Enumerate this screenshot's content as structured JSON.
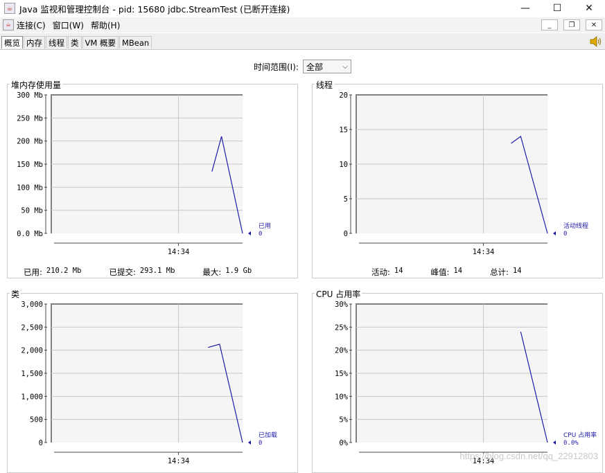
{
  "window": {
    "title": "Java 监视和管理控制台 - pid: 15680 jdbc.StreamTest (已断开连接)",
    "minimize_glyph": "—",
    "maximize_glyph": "☐",
    "close_glyph": "✕"
  },
  "menu": {
    "items": [
      {
        "label": "连接(C)"
      },
      {
        "label": "窗口(W)"
      },
      {
        "label": "帮助(H)"
      }
    ],
    "mdi_minimize": "_",
    "mdi_restore": "❐",
    "mdi_close": "✕"
  },
  "tabs": [
    {
      "label": "概览",
      "active": true
    },
    {
      "label": "内存"
    },
    {
      "label": "线程"
    },
    {
      "label": "类"
    },
    {
      "label": "VM 概要"
    },
    {
      "label": "MBean"
    }
  ],
  "time_range": {
    "label": "时间范围(I):",
    "selected": "全部"
  },
  "panels": {
    "heap": {
      "title": "堆内存使用量",
      "stats": [
        {
          "label": "已用:",
          "value": "210.2  Mb"
        },
        {
          "label": "已提交:",
          "value": "293.1  Mb"
        },
        {
          "label": "最大:",
          "value": "1.9  Gb"
        }
      ]
    },
    "threads": {
      "title": "线程",
      "stats": [
        {
          "label": "活动:",
          "value": "14"
        },
        {
          "label": "峰值:",
          "value": "14"
        },
        {
          "label": "总计:",
          "value": "14"
        }
      ]
    },
    "classes": {
      "title": "类"
    },
    "cpu": {
      "title": "CPU 占用率"
    }
  },
  "watermark": "https://blog.csdn.net/qq_22912803",
  "colors": {
    "series": "#1c1ca8",
    "grid": "#c8c8c8",
    "plot_bg": "#f5f5f5",
    "axis": "#444444"
  },
  "chart_data": [
    {
      "id": "heap",
      "type": "line",
      "yticks": [
        "300 Mb",
        "250 Mb",
        "200 Mb",
        "150 Mb",
        "100 Mb",
        "50 Mb",
        "0.0 Mb"
      ],
      "ylim": [
        0,
        300
      ],
      "xtick": "14:34",
      "series": [
        {
          "name": "已用",
          "x": [
            0.84,
            0.89,
            1.0
          ],
          "y": [
            134,
            210,
            0
          ]
        }
      ],
      "legend_value": "0"
    },
    {
      "id": "threads",
      "type": "line",
      "yticks": [
        "20",
        "15",
        "10",
        "5",
        "0"
      ],
      "ylim": [
        0,
        20
      ],
      "xtick": "14:34",
      "series": [
        {
          "name": "活动线程",
          "x": [
            0.81,
            0.86,
            1.0
          ],
          "y": [
            13,
            14,
            0
          ]
        }
      ],
      "legend_value": "0"
    },
    {
      "id": "classes",
      "type": "line",
      "yticks": [
        "3,000",
        "2,500",
        "2,000",
        "1,500",
        "1,000",
        "500",
        "0"
      ],
      "ylim": [
        0,
        3000
      ],
      "xtick": "14:34",
      "series": [
        {
          "name": "已加载",
          "x": [
            0.82,
            0.88,
            1.0
          ],
          "y": [
            2060,
            2130,
            0
          ]
        }
      ],
      "legend_value": "0"
    },
    {
      "id": "cpu",
      "type": "line",
      "yticks": [
        "30%",
        "25%",
        "20%",
        "15%",
        "10%",
        "5%",
        "0%"
      ],
      "ylim": [
        0,
        30
      ],
      "xtick": "14:34",
      "series": [
        {
          "name": "CPU 占用率",
          "x": [
            0.86,
            1.0
          ],
          "y": [
            24,
            0
          ]
        }
      ],
      "legend_value": "0.0%"
    }
  ]
}
